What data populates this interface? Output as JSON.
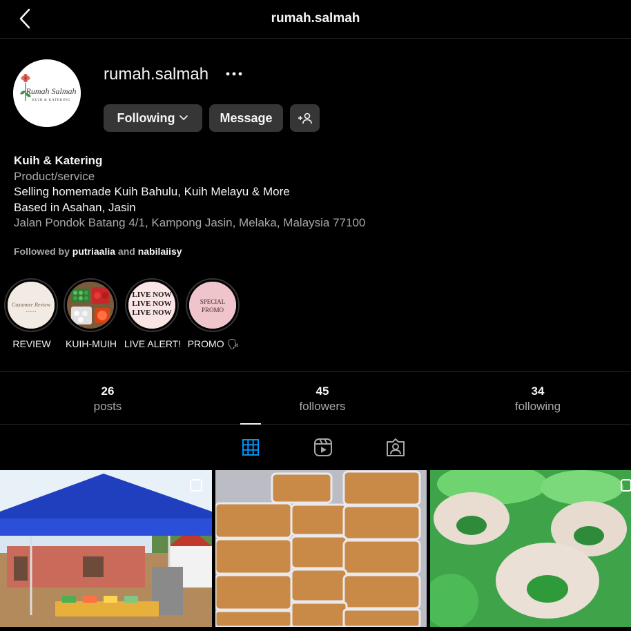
{
  "topbar": {
    "title": "rumah.salmah",
    "back_icon": "chevron-left-icon"
  },
  "profile": {
    "username": "rumah.salmah",
    "avatar_logo_text": "Rumah Salmah",
    "avatar_logo_subtext": "KUIH & KATERING",
    "buttons": {
      "following": "Following",
      "message": "Message"
    }
  },
  "bio": {
    "name": "Kuih & Katering",
    "category": "Product/service",
    "line1": "Selling homemade Kuih Bahulu, Kuih Melayu & More",
    "line2": "Based in Asahan, Jasin",
    "address": "Jalan Pondok Batang 4/1, Kampong Jasin, Melaka, Malaysia 77100"
  },
  "followed_by": {
    "prefix": "Followed by",
    "user1": "putriaalia",
    "joiner": "and",
    "user2": "nabilaiisy"
  },
  "highlights": [
    {
      "label": "REVIEW",
      "cover_text": "Customer Review"
    },
    {
      "label": "KUIH-MUIH",
      "cover_text": ""
    },
    {
      "label": "LIVE ALERT!",
      "cover_text": "LIVE NOW"
    },
    {
      "label": "PROMO 🗣",
      "cover_text_1": "SPECIAL",
      "cover_text_2": "PROMO"
    }
  ],
  "stats": {
    "posts": {
      "value": "26",
      "label": "posts"
    },
    "followers": {
      "value": "45",
      "label": "followers"
    },
    "following": {
      "value": "34",
      "label": "following"
    }
  },
  "tabs": {
    "icons": [
      "grid-icon",
      "reels-icon",
      "tagged-icon"
    ],
    "active": "grid-icon",
    "accent": "#0095f6"
  },
  "posts": [
    "tent-stall-photo",
    "kuih-containers-photo",
    "green-kuih-photo"
  ]
}
